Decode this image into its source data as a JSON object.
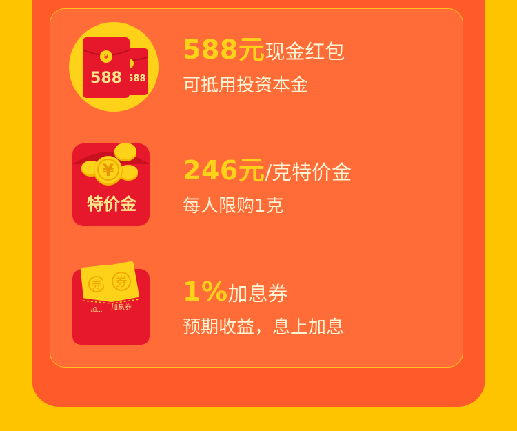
{
  "offers": [
    {
      "amount": "588元",
      "suffix": "现金红包",
      "desc": "可抵用投资本金",
      "icon_text": "588",
      "icon_text_back": "588",
      "icon_currency": "¥",
      "icon": "red-envelope-icon"
    },
    {
      "amount": "246元",
      "suffix": "/克特价金",
      "desc": "每人限购1克",
      "icon_text": "特价金",
      "icon_currency": "¥",
      "icon": "gold-coins-envelope-icon"
    },
    {
      "amount": "1%",
      "suffix": "加息券",
      "desc": "预期收益，息上加息",
      "icon_text": "加息券",
      "icon_text_back": "加...",
      "icon_ticket_char": "券",
      "icon": "coupon-envelope-icon"
    }
  ],
  "colors": {
    "page_bg": "#FFC400",
    "card_bg": "#FF5A2A",
    "panel_bg": "#FF6C38",
    "accent_yellow": "#FFD21A",
    "envelope_red": "#E8182C",
    "text_light": "#FFF4D6"
  }
}
